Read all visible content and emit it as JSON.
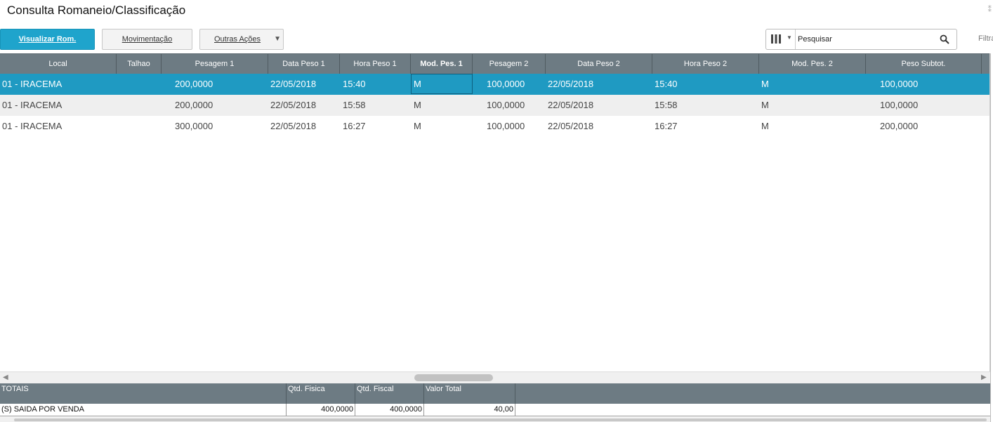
{
  "window": {
    "title": "Consulta Romaneio/Classificação"
  },
  "toolbar": {
    "visualizar_label": "Visualizar Rom.",
    "movimentacao_label": "Movimentação",
    "outras_label": "Outras Ações"
  },
  "search": {
    "placeholder": "Pesquisar",
    "filter_label": "Filtrar"
  },
  "grid": {
    "columns": [
      "Local",
      "Talhao",
      "Pesagem 1",
      "Data Peso 1",
      "Hora Peso 1",
      "Mod. Pes. 1",
      "Pesagem 2",
      "Data Peso 2",
      "Hora Peso 2",
      "Mod. Pes. 2",
      "Peso Subtot."
    ],
    "sorted_column": "Mod. Pes. 1",
    "rows": [
      {
        "local": "01 - IRACEMA",
        "talhao": "",
        "pesagem1": "200,0000",
        "data1": "22/05/2018",
        "hora1": "15:40",
        "mod1": "M",
        "pesagem2": "100,0000",
        "data2": "22/05/2018",
        "hora2": "15:40",
        "mod2": "M",
        "subtot": "100,0000"
      },
      {
        "local": "01 - IRACEMA",
        "talhao": "",
        "pesagem1": "200,0000",
        "data1": "22/05/2018",
        "hora1": "15:58",
        "mod1": "M",
        "pesagem2": "100,0000",
        "data2": "22/05/2018",
        "hora2": "15:58",
        "mod2": "M",
        "subtot": "100,0000"
      },
      {
        "local": "01 - IRACEMA",
        "talhao": "",
        "pesagem1": "300,0000",
        "data1": "22/05/2018",
        "hora1": "16:27",
        "mod1": "M",
        "pesagem2": "100,0000",
        "data2": "22/05/2018",
        "hora2": "16:27",
        "mod2": "M",
        "subtot": "200,0000"
      }
    ]
  },
  "totals": {
    "headers": [
      "TOTAIS",
      "Qtd. Fisica",
      "Qtd. Fiscal",
      "Valor Total"
    ],
    "row": {
      "label": "(S) SAIDA POR VENDA",
      "qtd_fisica": "400,0000",
      "qtd_fiscal": "400,0000",
      "valor_total": "40,00"
    }
  },
  "colors": {
    "accent": "#1fa4cc",
    "header_bg": "#6d7b83",
    "selected_row": "#1f9ac2"
  }
}
